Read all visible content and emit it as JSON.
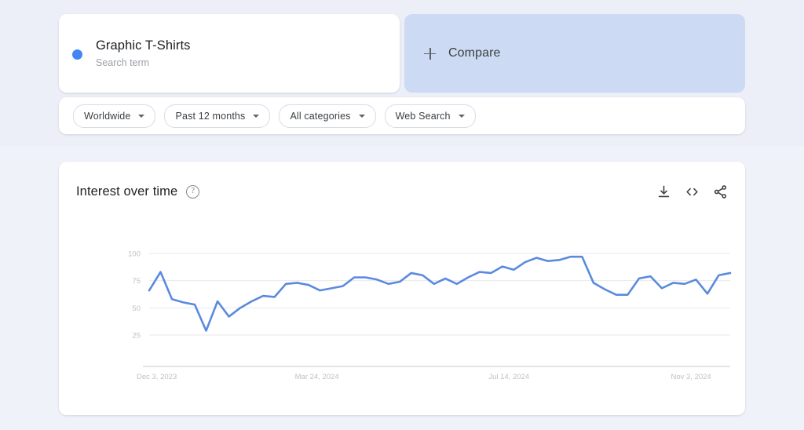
{
  "term_card": {
    "title": "Graphic T-Shirts",
    "subtitle": "Search term",
    "dot_color": "#4285f4"
  },
  "compare_card": {
    "label": "Compare",
    "icon": "plus-icon",
    "background": "#ccdaf3"
  },
  "filters": [
    {
      "label": "Worldwide",
      "icon": "chevron-down-icon"
    },
    {
      "label": "Past 12 months",
      "icon": "chevron-down-icon"
    },
    {
      "label": "All categories",
      "icon": "chevron-down-icon"
    },
    {
      "label": "Web Search",
      "icon": "chevron-down-icon"
    }
  ],
  "chart_card": {
    "title": "Interest over time",
    "help_icon": "help-circle-icon",
    "help_glyph": "?",
    "actions": [
      {
        "name": "download-icon",
        "title": "Download"
      },
      {
        "name": "embed-code-icon",
        "title": "Embed"
      },
      {
        "name": "share-icon",
        "title": "Share"
      }
    ]
  },
  "chart_data": {
    "type": "line",
    "title": "Interest over time",
    "xlabel": "",
    "ylabel": "",
    "ylim": [
      0,
      100
    ],
    "yticks": [
      25,
      50,
      75,
      100
    ],
    "grid": true,
    "legend": "none",
    "line_color": "#5b8ade",
    "x_tick_labels": [
      "Dec 3, 2023",
      "Mar 24, 2024",
      "Jul 14, 2024",
      "Nov 3, 2024"
    ],
    "x_tick_positions": [
      0,
      15,
      32,
      48
    ],
    "series": [
      {
        "name": "Graphic T-Shirts",
        "values": [
          66,
          83,
          58,
          55,
          53,
          29,
          56,
          42,
          50,
          56,
          61,
          60,
          72,
          73,
          71,
          66,
          68,
          70,
          78,
          78,
          76,
          72,
          74,
          82,
          80,
          72,
          77,
          72,
          78,
          83,
          82,
          88,
          85,
          92,
          96,
          93,
          94,
          97,
          97,
          73,
          67,
          62,
          62,
          77,
          79,
          68,
          73,
          72,
          76,
          63,
          80,
          82
        ]
      }
    ]
  }
}
